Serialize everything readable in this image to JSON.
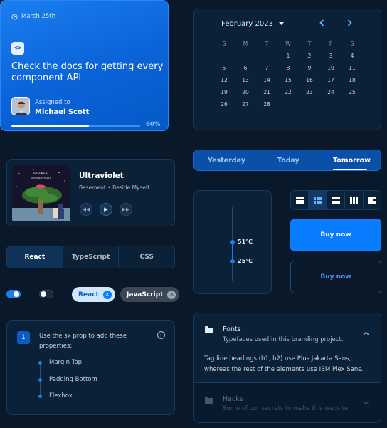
{
  "task": {
    "date": "March 25th",
    "title": "Check the docs for getting every component API",
    "assigned_label": "Assigned to",
    "assignee": "Michael Scott",
    "progress_label": "60%",
    "progress": 0.6
  },
  "calendar": {
    "month": "February 2023",
    "weekdays": [
      "S",
      "M",
      "T",
      "W",
      "T",
      "F",
      "S"
    ],
    "days": [
      "",
      "",
      "",
      "1",
      "2",
      "3",
      "4",
      "5",
      "6",
      "7",
      "8",
      "9",
      "10",
      "11",
      "12",
      "13",
      "14",
      "15",
      "16",
      "17",
      "18",
      "19",
      "20",
      "21",
      "22",
      "23",
      "24",
      "25",
      "26",
      "27",
      "28",
      "",
      "",
      "",
      ""
    ]
  },
  "player": {
    "cover_text": "BASEMENT\nBESIDE MYSELF",
    "song": "Ultraviolet",
    "artist": "Basement • Beside Myself"
  },
  "day_tabs": [
    "Yesterday",
    "Today",
    "Tomorrow"
  ],
  "slider": {
    "high": "51°C",
    "low": "25°C"
  },
  "buttons": {
    "buy_primary": "Buy now",
    "buy_outlined": "Buy now"
  },
  "lang_tabs": [
    "React",
    "TypeScript",
    "CSS"
  ],
  "chips": [
    "React",
    "JavaScript"
  ],
  "steps": {
    "number": "1",
    "description": "Use the sx prop to add these properties:",
    "items": [
      "Margin Top",
      "Padding Bottom",
      "Flexbox"
    ]
  },
  "accordion": {
    "fonts_title": "Fonts",
    "fonts_sub": "Typefaces used in this branding project.",
    "fonts_body": "Tag line headings (h1, h2) use Plus Jakarta Sans, whereas the rest of the elements use IBM Plex Sans.",
    "hacks_title": "Hacks",
    "hacks_sub": "Some of our secrets to make this website."
  },
  "colors": {
    "primary": "#0a7cff",
    "background": "#0a1929",
    "surface": "#0b2138",
    "border": "#173a5e"
  }
}
